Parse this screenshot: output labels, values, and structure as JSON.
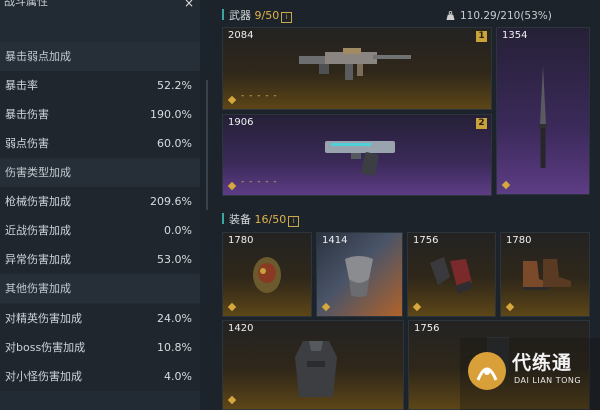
{
  "stats_panel": {
    "title": "战斗属性",
    "close_glyph": "×",
    "rows": [
      {
        "type": "section",
        "label": "暴击弱点加成"
      },
      {
        "type": "item",
        "label": "暴击率",
        "value": "52.2%"
      },
      {
        "type": "item",
        "label": "暴击伤害",
        "value": "190.0%"
      },
      {
        "type": "item",
        "label": "弱点伤害",
        "value": "60.0%"
      },
      {
        "type": "section",
        "label": "伤害类型加成"
      },
      {
        "type": "item",
        "label": "枪械伤害加成",
        "value": "209.6%"
      },
      {
        "type": "item",
        "label": "近战伤害加成",
        "value": "0.0%"
      },
      {
        "type": "item",
        "label": "异常伤害加成",
        "value": "53.0%"
      },
      {
        "type": "section",
        "label": "其他伤害加成"
      },
      {
        "type": "item",
        "label": "对精英伤害加成",
        "value": "24.0%"
      },
      {
        "type": "item",
        "label": "对boss伤害加成",
        "value": "10.8%"
      },
      {
        "type": "item",
        "label": "对小怪伤害加成",
        "value": "4.0%"
      }
    ]
  },
  "weapons": {
    "label": "武器",
    "count": "9/50",
    "info_glyph": "i",
    "cards": [
      {
        "power": "2084",
        "slot": "1",
        "rarity": "gold",
        "icon": "rifle-icon"
      },
      {
        "power": "1354",
        "slot": "",
        "rarity": "purple",
        "icon": "knife-icon"
      },
      {
        "power": "1906",
        "slot": "2",
        "rarity": "purple",
        "icon": "pistol-icon"
      }
    ],
    "dashes": "- - - - -",
    "dashes2": "- - - - -"
  },
  "weight": {
    "text": "110.29/210(53%)",
    "icon": "weight-icon"
  },
  "gear": {
    "label": "装备",
    "count": "16/50",
    "info_glyph": "i",
    "cards": [
      {
        "power": "1780",
        "rarity": "gold",
        "icon": "helmet-icon"
      },
      {
        "power": "1414",
        "rarity": "gold",
        "icon": "mask-icon"
      },
      {
        "power": "1756",
        "rarity": "gold",
        "icon": "gloves-icon"
      },
      {
        "power": "1780",
        "rarity": "gold",
        "icon": "boots-icon"
      },
      {
        "power": "1420",
        "rarity": "gold",
        "icon": "jacket-icon"
      },
      {
        "power": "1756",
        "rarity": "gold",
        "icon": "pants-icon"
      }
    ]
  },
  "watermark": {
    "title": "代练通",
    "subtitle": "DAI LIAN TONG"
  },
  "colors": {
    "gold": "#caa23a",
    "purple": "#5d3c85",
    "accent": "#3aa6a0"
  }
}
